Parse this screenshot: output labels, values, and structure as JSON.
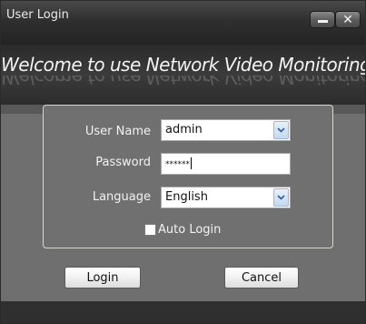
{
  "window": {
    "title": "User Login",
    "minimize_icon": "minimize-icon",
    "close_label": "✕"
  },
  "banner": {
    "text": "Welcome to use Network Video Monitoring System"
  },
  "form": {
    "username_label": "User Name",
    "username_value": "admin",
    "password_label": "Password",
    "password_value": "******",
    "language_label": "Language",
    "language_value": "English",
    "auto_login_label": "Auto Login",
    "auto_login_checked": false
  },
  "buttons": {
    "login_label": "Login",
    "cancel_label": "Cancel"
  }
}
